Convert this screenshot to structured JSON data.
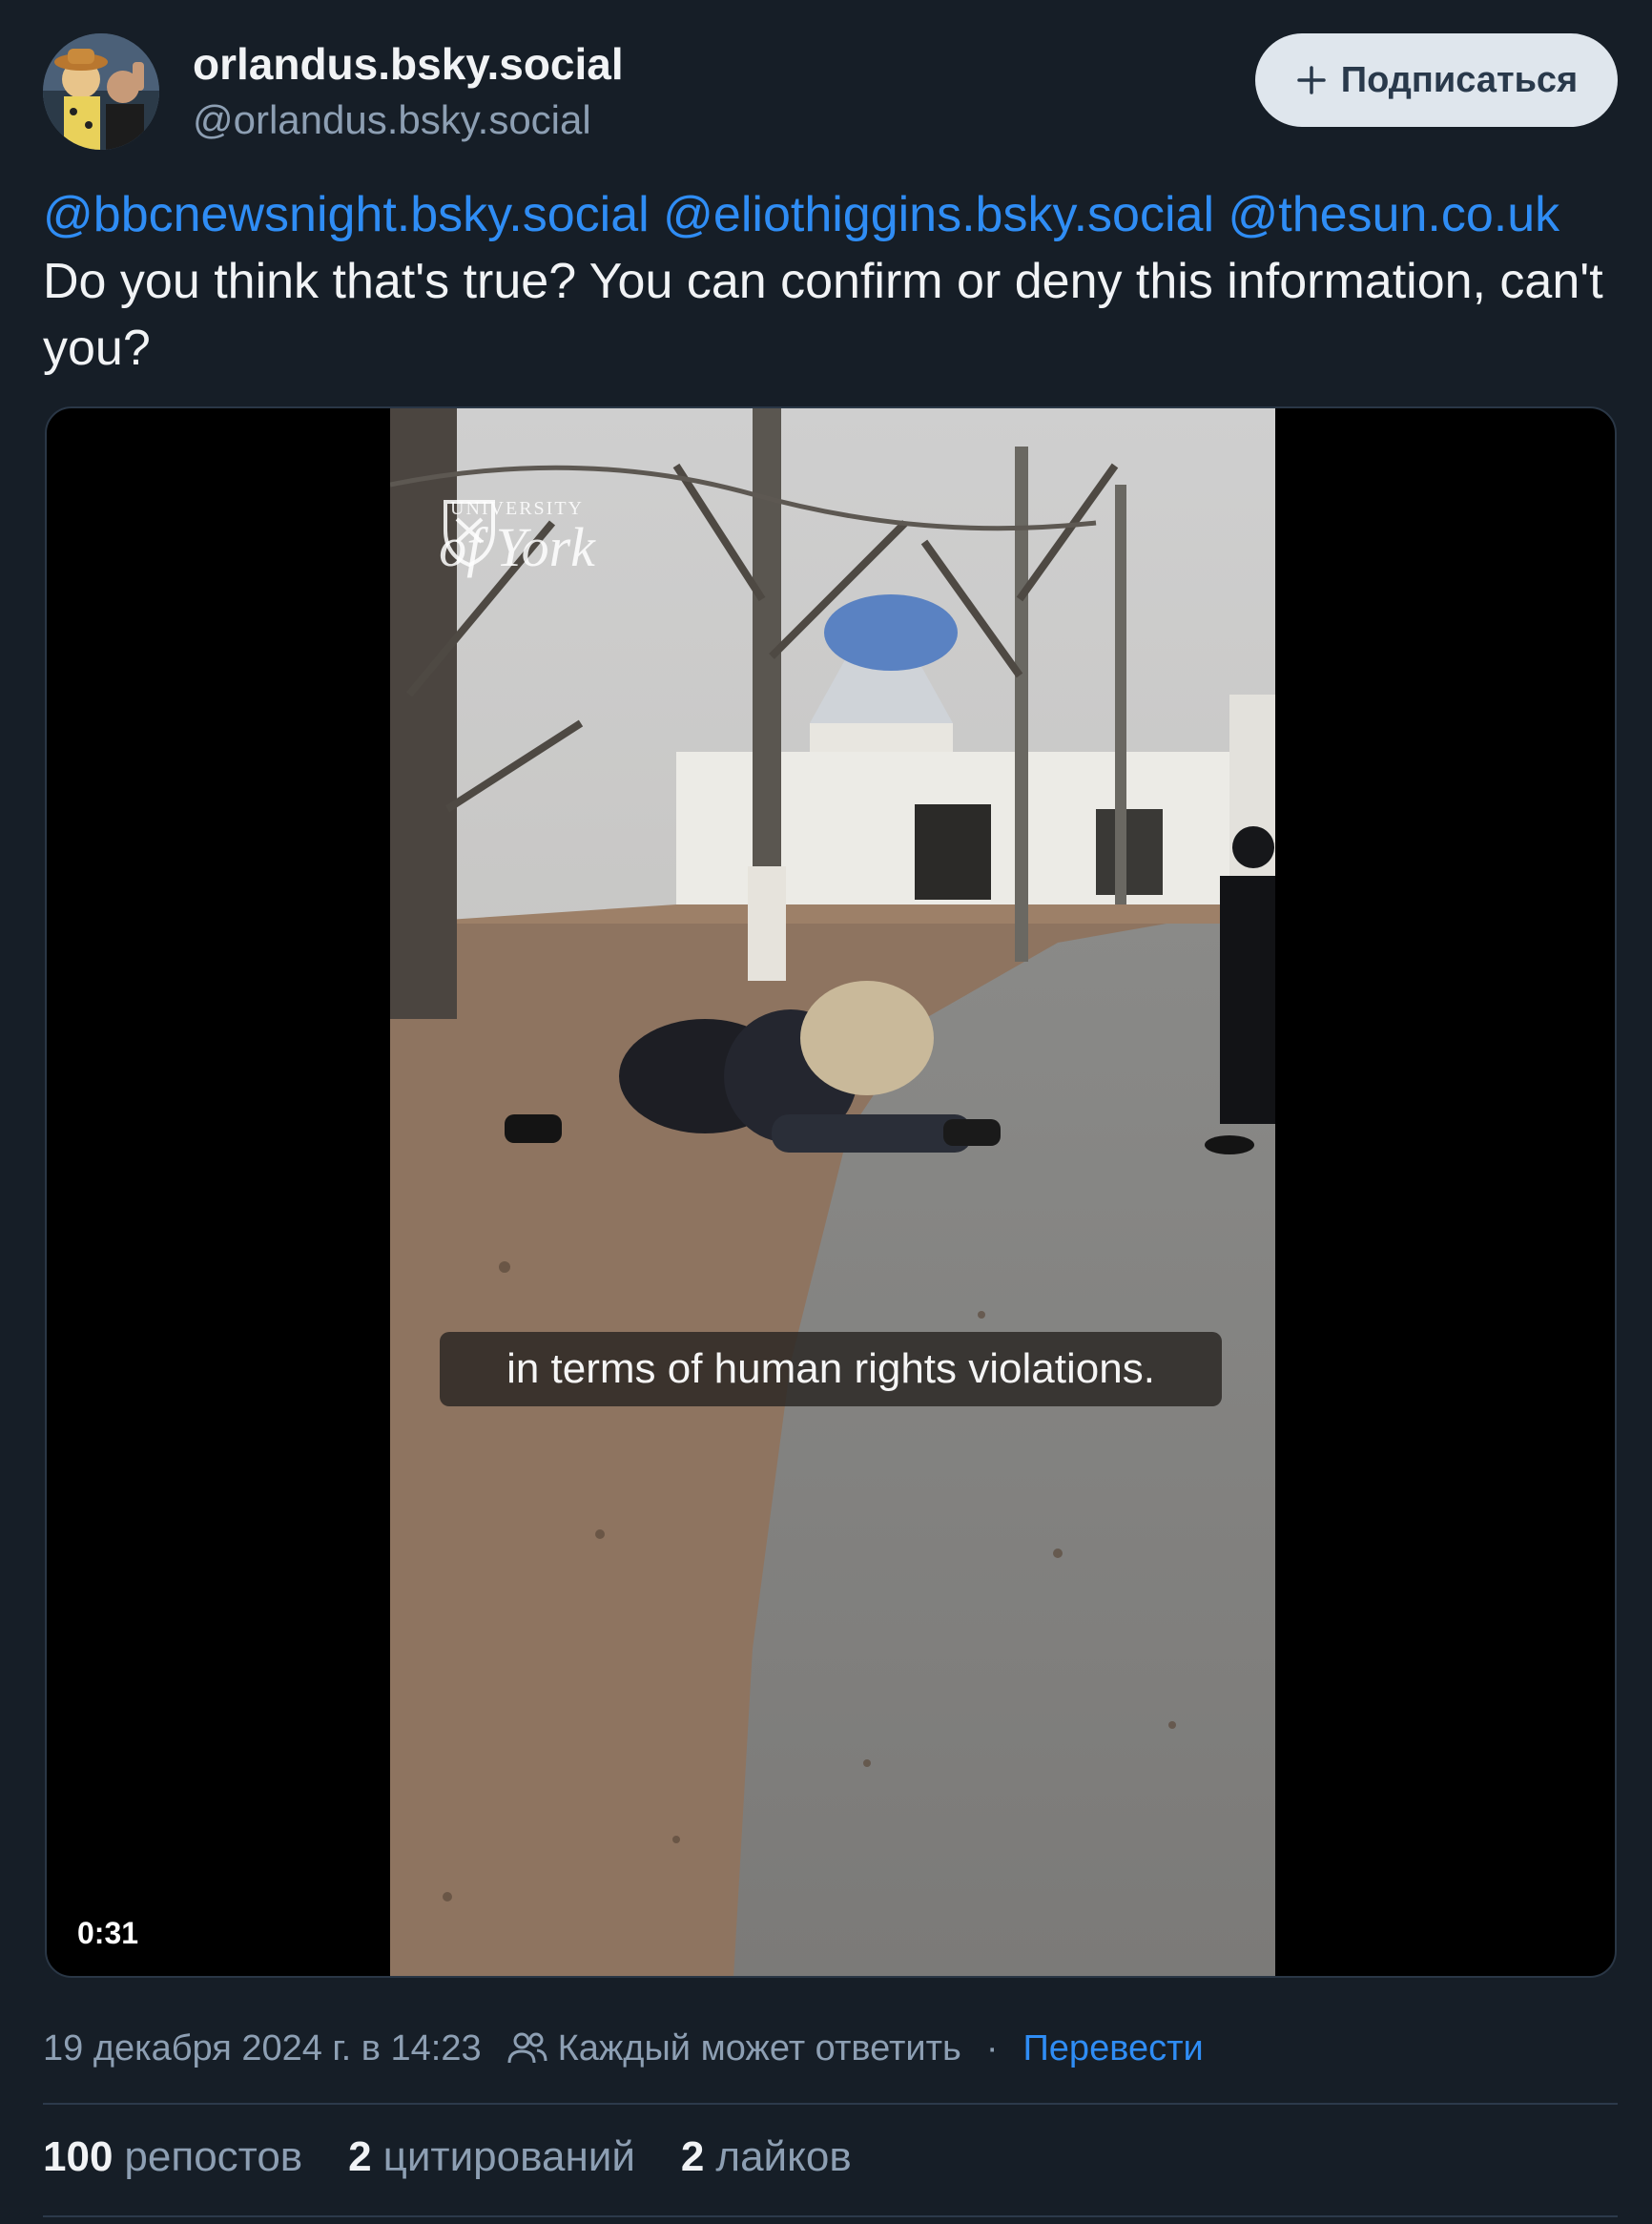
{
  "author": {
    "display_name": "orlandus.bsky.social",
    "handle": "@orlandus.bsky.social"
  },
  "follow_button": {
    "label": "Подписаться",
    "icon": "plus-icon"
  },
  "post": {
    "mentions": [
      "@bbcnewsnight.bsky.social",
      "@eliothiggins.bsky.social",
      "@thesun.co.uk"
    ],
    "text": "Do you think that's true? You can confirm or deny this information, can't you?"
  },
  "video": {
    "caption": "in terms of human rights violations.",
    "watermark_line1": "UNIVERSITY",
    "watermark_line2": "of York",
    "duration": "0:31"
  },
  "meta": {
    "timestamp": "19 декабря 2024 г. в 14:23",
    "reply_setting": "Каждый может ответить",
    "separator": "·",
    "translate_link": "Перевести"
  },
  "stats": [
    {
      "count": "100",
      "label": "репостов"
    },
    {
      "count": "2",
      "label": "цитирований"
    },
    {
      "count": "2",
      "label": "лайков"
    }
  ],
  "colors": {
    "background": "#161e27",
    "accent_link": "#2f8df5",
    "muted_text": "#8d9fb3",
    "follow_button_bg": "#dfe6ed"
  }
}
